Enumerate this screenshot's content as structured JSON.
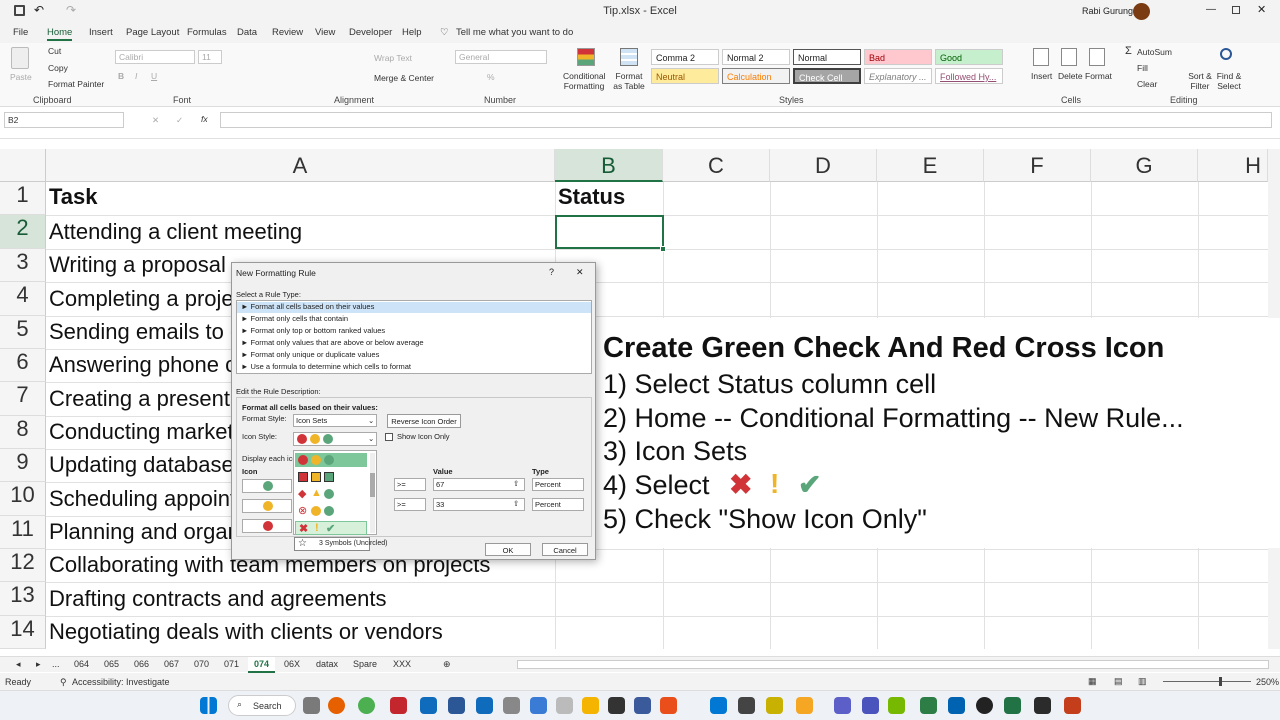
{
  "window": {
    "title": "Tip.xlsx - Excel",
    "user": "Rabi Gurung"
  },
  "tabs": [
    "File",
    "Home",
    "Insert",
    "Page Layout",
    "Formulas",
    "Data",
    "Review",
    "View",
    "Developer",
    "Help",
    "Tell me what you want to do"
  ],
  "ribbon": {
    "clipboard": {
      "paste": "Paste",
      "cut": "Cut",
      "copy": "Copy",
      "painter": "Format Painter",
      "label": "Clipboard"
    },
    "font": {
      "name": "Calibri",
      "size": "11",
      "label": "Font"
    },
    "alignment": {
      "wrap": "Wrap Text",
      "merge": "Merge & Center",
      "label": "Alignment"
    },
    "number": {
      "format": "General",
      "label": "Number"
    },
    "styles": {
      "cond": "Conditional Formatting",
      "table": "Format as Table",
      "label": "Styles",
      "cells": [
        "Comma 2",
        "Normal 2",
        "Normal",
        "Bad",
        "Good",
        "Neutral",
        "Calculation",
        "Check Cell",
        "Explanatory ...",
        "Followed Hy..."
      ]
    },
    "cells": {
      "insert": "Insert",
      "delete": "Delete",
      "format": "Format",
      "label": "Cells"
    },
    "editing": {
      "autosum": "AutoSum",
      "fill": "Fill",
      "clear": "Clear",
      "sort": "Sort & Filter",
      "find": "Find & Select",
      "label": "Editing"
    }
  },
  "formula": {
    "namebox": "B2"
  },
  "columns": [
    "A",
    "B",
    "C",
    "D",
    "E",
    "F",
    "G",
    "H"
  ],
  "rows": [
    {
      "n": "1",
      "a": "Task",
      "b": "Status"
    },
    {
      "n": "2",
      "a": "Attending a client meeting",
      "b": ""
    },
    {
      "n": "3",
      "a": "Writing a proposal",
      "b": ""
    },
    {
      "n": "4",
      "a": "Completing a project",
      "b": ""
    },
    {
      "n": "5",
      "a": "Sending emails to clients",
      "b": ""
    },
    {
      "n": "6",
      "a": "Answering phone calls",
      "b": ""
    },
    {
      "n": "7",
      "a": "Creating a presentation",
      "b": ""
    },
    {
      "n": "8",
      "a": "Conducting market research",
      "b": ""
    },
    {
      "n": "9",
      "a": "Updating database records",
      "b": ""
    },
    {
      "n": "10",
      "a": "Scheduling appointments",
      "b": ""
    },
    {
      "n": "11",
      "a": "Planning and organizing events",
      "b": ""
    },
    {
      "n": "12",
      "a": "Collaborating with team members on projects",
      "b": ""
    },
    {
      "n": "13",
      "a": "Drafting contracts and agreements",
      "b": ""
    },
    {
      "n": "14",
      "a": "Negotiating deals with clients or vendors",
      "b": ""
    }
  ],
  "sheets": [
    "...",
    "064",
    "065",
    "066",
    "067",
    "070",
    "071",
    "074",
    "06X",
    "datax",
    "Spare",
    "XXX"
  ],
  "active_sheet": "074",
  "status": {
    "ready": "Ready",
    "access": "Accessibility: Investigate",
    "zoom": "250%"
  },
  "taskbar": {
    "search": "Search"
  },
  "dialog": {
    "title": "New Formatting Rule",
    "help": "?",
    "close": "✕",
    "select_label": "Select a Rule Type:",
    "rules": [
      "Format all cells based on their values",
      "Format only cells that contain",
      "Format only top or bottom ranked values",
      "Format only values that are above or below average",
      "Format only unique or duplicate values",
      "Use a formula to determine which cells to format"
    ],
    "edit_label": "Edit the Rule Description:",
    "desc_head": "Format all cells based on their values:",
    "format_style_label": "Format Style:",
    "format_style": "Icon Sets",
    "reverse": "Reverse Icon Order",
    "icon_style_label": "Icon Style:",
    "show_icon_only": "Show Icon Only",
    "display_label": "Display each icon according to these rules:",
    "icon_col": "Icon",
    "value_col": "Value",
    "type_col": "Type",
    "op": ">=",
    "v1": "67",
    "v2": "33",
    "t1": "Percent",
    "t2": "Percent",
    "tooltip": "3 Symbols (Uncircled)",
    "ok": "OK",
    "cancel": "Cancel"
  },
  "overlay": {
    "title": "Create Green Check And Red Cross Icon",
    "step1": "1) Select Status column cell",
    "step2": "2) Home -- Conditional Formatting -- New Rule...",
    "step3": "3) Icon Sets",
    "step4": "4) Select",
    "step5": "5) Check \"Show Icon Only\""
  },
  "colors": {
    "accent": "#217346",
    "red": "#d13438",
    "green": "#5aa67a",
    "yellow": "#f0b429"
  }
}
